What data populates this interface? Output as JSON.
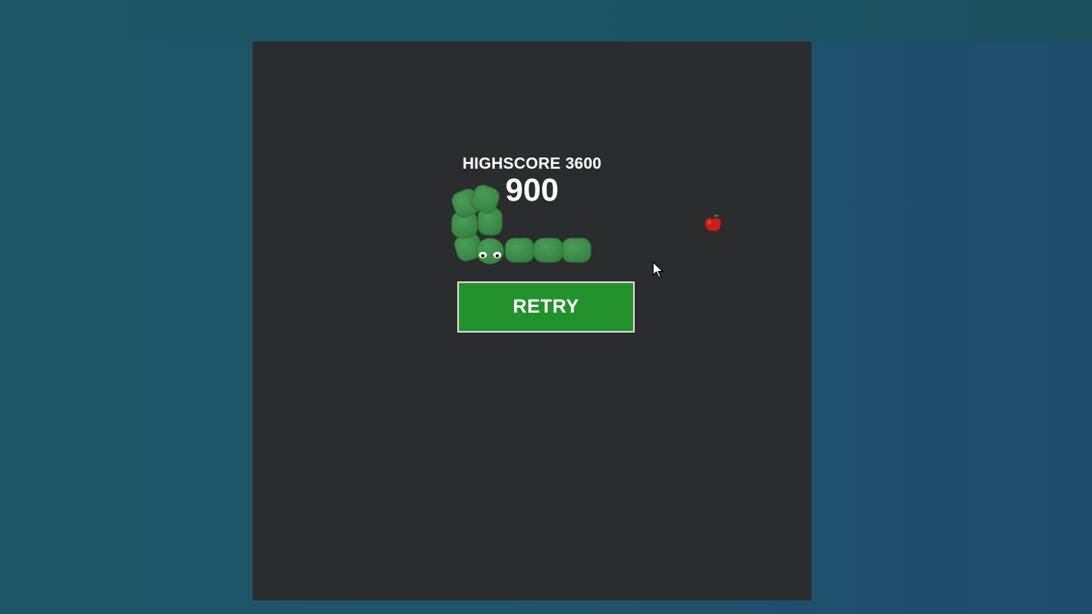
{
  "game": {
    "highscore_label": "HIGHSCORE",
    "highscore_value": "3600",
    "score": "900",
    "retry_label": "RETRY"
  },
  "colors": {
    "page_background": "#1d5568",
    "board_background": "#2a2c2e",
    "snake_green": "#3e8f4c",
    "button_green": "#22922d",
    "apple_red": "#c8201a"
  },
  "icons": {
    "snake": "snake-icon",
    "apple": "apple-icon",
    "cursor": "mouse-pointer-icon"
  },
  "snake": {
    "length": 9,
    "head_direction": "left"
  }
}
